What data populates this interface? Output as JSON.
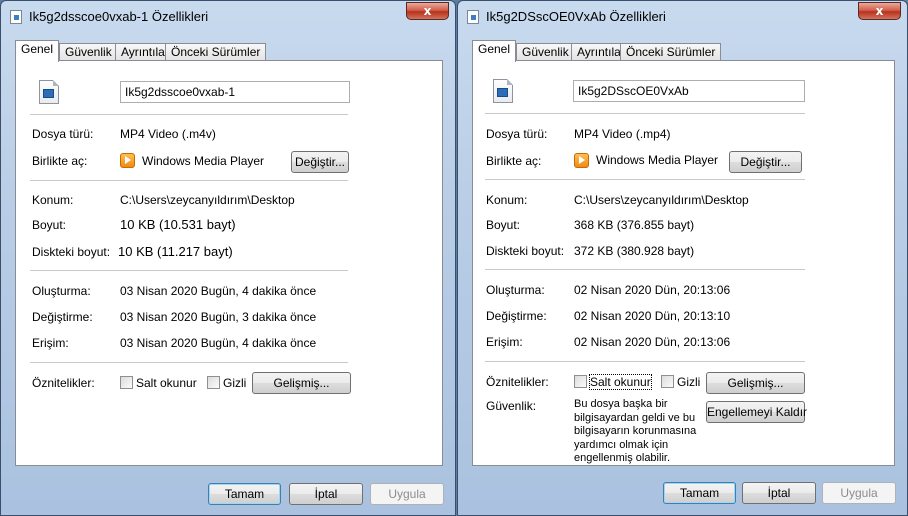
{
  "windows": [
    {
      "title": "Ik5g2dsscoe0vxab-1 Özellikleri",
      "tabs": [
        "Genel",
        "Güvenlik",
        "Ayrıntılar",
        "Önceki Sürümler"
      ],
      "file_name": "Ik5g2dsscoe0vxab-1",
      "labels": {
        "type": "Dosya türü:",
        "opens_with": "Birlikte aç:",
        "location": "Konum:",
        "size": "Boyut:",
        "size_on_disk": "Diskteki boyut:",
        "created": "Oluşturma:",
        "modified": "Değiştirme:",
        "accessed": "Erişim:",
        "attributes": "Öznitelikler:"
      },
      "values": {
        "type": "MP4 Video (.m4v)",
        "opens_with_app": "Windows Media Player",
        "location": "C:\\Users\\zeycanyıldırım\\Desktop",
        "size": "10 KB (10.531 bayt)",
        "size_on_disk": "10 KB (11.217 bayt)",
        "created": "03 Nisan 2020 Bugün, 4 dakika önce",
        "modified": "03 Nisan 2020 Bugün, 3 dakika önce",
        "accessed": "03 Nisan 2020 Bugün, 4 dakika önce"
      },
      "buttons": {
        "change": "Değiştir...",
        "advanced": "Gelişmiş...",
        "ok": "Tamam",
        "cancel": "İptal",
        "apply": "Uygula"
      },
      "checkboxes": {
        "readonly": "Salt okunur",
        "hidden": "Gizli"
      }
    },
    {
      "title": "Ik5g2DSscOE0VxAb Özellikleri",
      "tabs": [
        "Genel",
        "Güvenlik",
        "Ayrıntılar",
        "Önceki Sürümler"
      ],
      "file_name": "Ik5g2DSscOE0VxAb",
      "labels": {
        "type": "Dosya türü:",
        "opens_with": "Birlikte aç:",
        "location": "Konum:",
        "size": "Boyut:",
        "size_on_disk": "Diskteki boyut:",
        "created": "Oluşturma:",
        "modified": "Değiştirme:",
        "accessed": "Erişim:",
        "attributes": "Öznitelikler:",
        "security": "Güvenlik:"
      },
      "values": {
        "type": "MP4 Video (.mp4)",
        "opens_with_app": "Windows Media Player",
        "location": "C:\\Users\\zeycanyıldırım\\Desktop",
        "size": "368 KB (376.855 bayt)",
        "size_on_disk": "372 KB (380.928 bayt)",
        "created": "02 Nisan 2020 Dün, 20:13:06",
        "modified": "02 Nisan 2020 Dün, 20:13:10",
        "accessed": "02 Nisan 2020 Dün, 20:13:06",
        "security_text": "Bu dosya başka bir bilgisayardan geldi ve bu bilgisayarın korunmasına yardımcı olmak için engellenmiş olabilir."
      },
      "buttons": {
        "change": "Değiştir...",
        "advanced": "Gelişmiş...",
        "unblock": "Engellemeyi Kaldır",
        "ok": "Tamam",
        "cancel": "İptal",
        "apply": "Uygula"
      },
      "checkboxes": {
        "readonly": "Salt okunur",
        "hidden": "Gizli"
      }
    }
  ],
  "title_buttons": {
    "close": "x"
  }
}
